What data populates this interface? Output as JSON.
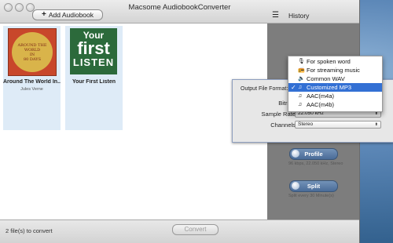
{
  "window": {
    "title": "Macsome AudiobookConverter"
  },
  "toolbar": {
    "add_label": "Add Audiobook",
    "add_icon": "plus-icon",
    "history_label": "History",
    "history_icon": "list-icon"
  },
  "books": [
    {
      "title": "Around The World In...",
      "author": "Jules Verne",
      "cover_text": [
        "AROUND THE",
        "WORLD",
        "IN",
        "80 DAYS"
      ]
    },
    {
      "title": "Your First Listen",
      "author": "",
      "cover_text": [
        "Your",
        "first",
        "LISTEN"
      ]
    }
  ],
  "status": {
    "files": "2 file(s) to convert",
    "convert_label": "Convert"
  },
  "output_sheet": {
    "format_label": "Output File Format:",
    "bitrate_label": "Bitrate:",
    "sample_rate_label": "Sample Rate:",
    "sample_rate_value": "22.050 kHz",
    "channels_label": "Channels:",
    "channels_value": "Stereo"
  },
  "format_menu": {
    "items": [
      {
        "label": "For spoken word",
        "icon": "microphone-icon",
        "selected": false
      },
      {
        "label": "For streaming music",
        "icon": "radio-icon",
        "selected": false
      },
      {
        "label": "Common WAV",
        "icon": "speaker-icon",
        "selected": false
      },
      {
        "label": "Customized MP3",
        "icon": "music-file-icon",
        "selected": true
      },
      {
        "label": "AAC(m4a)",
        "icon": "music-file-icon",
        "selected": false
      },
      {
        "label": "AAC(m4b)",
        "icon": "music-file-icon",
        "selected": false
      }
    ]
  },
  "side": {
    "profile_label": "Profile",
    "profile_note": "96 kbps, 22.050 kHz, Stereo",
    "split_label": "Split",
    "split_note": "Split every 30 Minute(s)"
  }
}
